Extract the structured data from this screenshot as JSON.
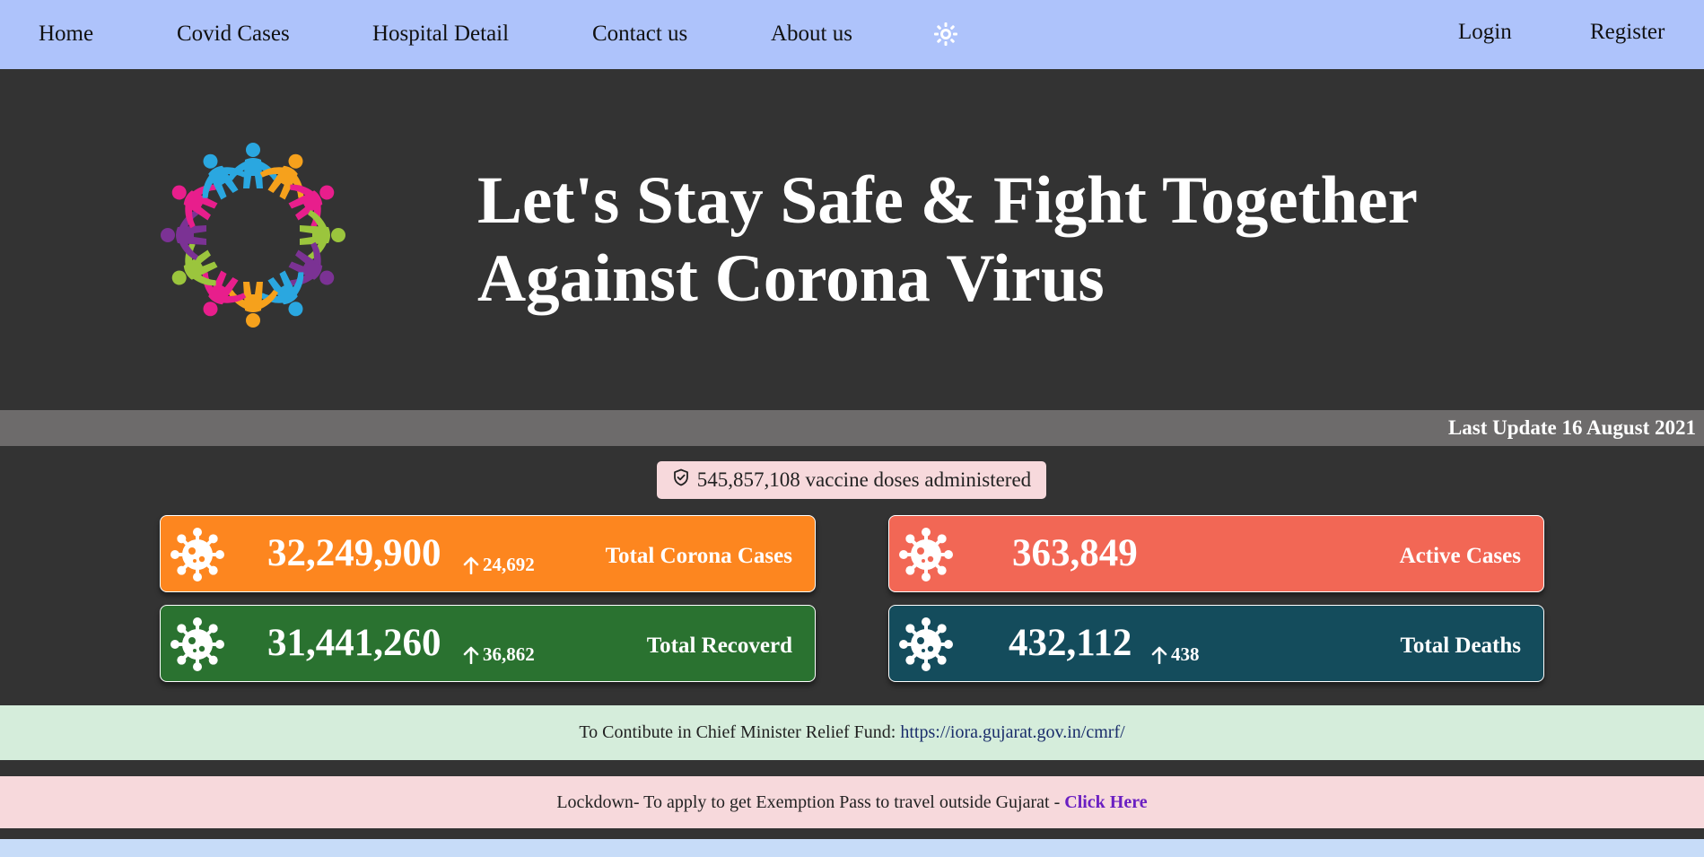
{
  "nav": {
    "items": [
      {
        "label": "Home"
      },
      {
        "label": "Covid Cases"
      },
      {
        "label": "Hospital Detail"
      },
      {
        "label": "Contact us"
      },
      {
        "label": "About us"
      }
    ],
    "theme_icon": "sun-icon",
    "login_label": "Login",
    "register_label": "Register"
  },
  "hero": {
    "logo_icon": "people-circle-logo",
    "title_line1": "Let's Stay Safe & Fight Together",
    "title_line2": "Against Corona Virus"
  },
  "update": {
    "text": "Last Update 16 August 2021"
  },
  "vaccine": {
    "icon": "shield-check-icon",
    "text": "545,857,108 vaccine doses administered"
  },
  "stats": [
    {
      "label": "Total Corona Cases",
      "value": "32,249,900",
      "delta": "24,692",
      "color": "#fd861f",
      "icon": "virus-icon"
    },
    {
      "label": "Active Cases",
      "value": "363,849",
      "delta": "",
      "color": "#f26755",
      "icon": "virus-icon"
    },
    {
      "label": "Total Recoverd",
      "value": "31,441,260",
      "delta": "36,862",
      "color": "#2a7230",
      "icon": "virus-icon"
    },
    {
      "label": "Total Deaths",
      "value": "432,112",
      "delta": "438",
      "color": "#144c5c",
      "icon": "virus-icon"
    }
  ],
  "relief_banner": {
    "text": "To Contibute in Chief Minister Relief Fund: ",
    "link": "https://iora.gujarat.gov.in/cmrf/",
    "bg": "#d5eddb",
    "link_color": "#1a2d6b"
  },
  "lockdown_banner": {
    "text": "Lockdown- To apply to get Exemption Pass to travel outside Gujarat - ",
    "link": "Click Here",
    "bg": "#f7d9dc",
    "link_color": "#6a1fc2"
  },
  "colors": {
    "nav_bg": "#aec3fb",
    "page_bg": "#333333",
    "update_bar_bg": "#6d6b6b"
  }
}
